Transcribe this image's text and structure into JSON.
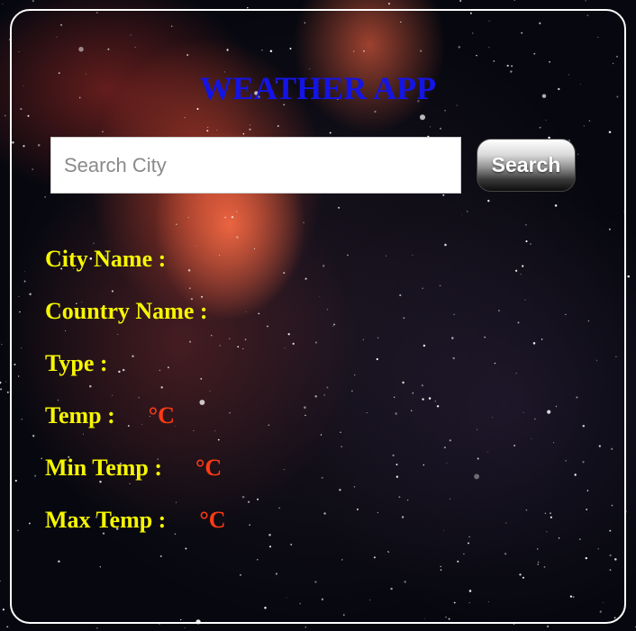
{
  "app": {
    "title": "WEATHER APP"
  },
  "search": {
    "placeholder": "Search City",
    "value": "",
    "button_label": "Search"
  },
  "fields": {
    "city_label": "City Name :",
    "city_value": "",
    "country_label": "Country Name :",
    "country_value": "",
    "type_label": "Type :",
    "type_value": "",
    "temp_label": "Temp :",
    "temp_value": "",
    "min_temp_label": "Min Temp :",
    "min_temp_value": "",
    "max_temp_label": "Max Temp :",
    "max_temp_value": "",
    "unit": "°C"
  },
  "colors": {
    "title": "#1414e6",
    "label": "#f6f600",
    "unit": "#ff3b13",
    "card_border": "#ffffff"
  }
}
